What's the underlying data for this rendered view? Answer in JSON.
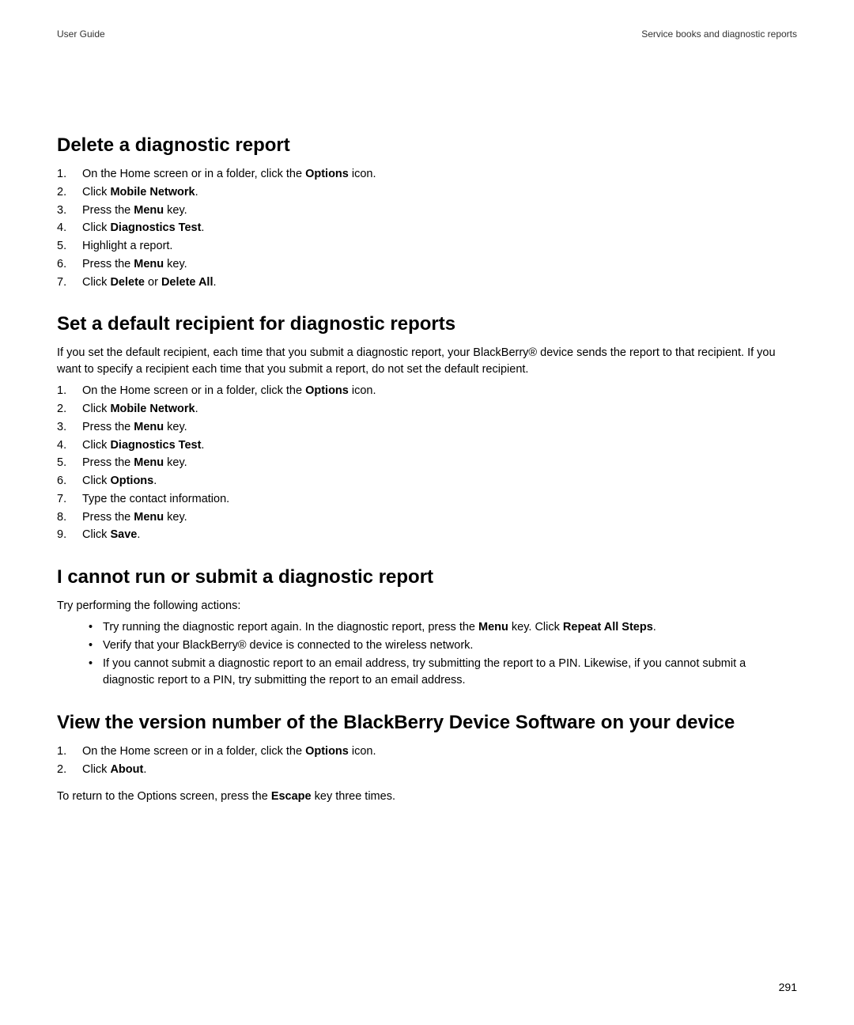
{
  "header": {
    "left": "User Guide",
    "right": "Service books and diagnostic reports"
  },
  "sections": {
    "s1": {
      "title": "Delete a diagnostic report",
      "steps": [
        {
          "pre": "On the Home screen or in a folder, click the ",
          "bold": "Options",
          "post": " icon."
        },
        {
          "pre": "Click ",
          "bold": "Mobile Network",
          "post": "."
        },
        {
          "pre": "Press the ",
          "bold": "Menu",
          "post": " key."
        },
        {
          "pre": "Click ",
          "bold": "Diagnostics Test",
          "post": "."
        },
        {
          "pre": "Highlight a report.",
          "bold": "",
          "post": ""
        },
        {
          "pre": "Press the ",
          "bold": "Menu",
          "post": " key."
        },
        {
          "pre": "Click ",
          "bold": "Delete",
          "mid": " or ",
          "bold2": "Delete All",
          "post": "."
        }
      ]
    },
    "s2": {
      "title": "Set a default recipient for diagnostic reports",
      "intro": "If you set the default recipient, each time that you submit a diagnostic report, your BlackBerry® device sends the report to that recipient. If you want to specify a recipient each time that you submit a report, do not set the default recipient.",
      "steps": [
        {
          "pre": "On the Home screen or in a folder, click the ",
          "bold": "Options",
          "post": " icon."
        },
        {
          "pre": "Click ",
          "bold": "Mobile Network",
          "post": "."
        },
        {
          "pre": "Press the ",
          "bold": "Menu",
          "post": " key."
        },
        {
          "pre": "Click ",
          "bold": "Diagnostics Test",
          "post": "."
        },
        {
          "pre": "Press the ",
          "bold": "Menu",
          "post": " key."
        },
        {
          "pre": "Click ",
          "bold": "Options",
          "post": "."
        },
        {
          "pre": "Type the contact information.",
          "bold": "",
          "post": ""
        },
        {
          "pre": "Press the ",
          "bold": "Menu",
          "post": " key."
        },
        {
          "pre": "Click ",
          "bold": "Save",
          "post": "."
        }
      ]
    },
    "s3": {
      "title": "I cannot run or submit a diagnostic report",
      "intro": "Try performing the following actions:",
      "bullets": [
        {
          "pre": "Try running the diagnostic report again. In the diagnostic report, press the ",
          "bold": "Menu",
          "mid": " key. Click ",
          "bold2": "Repeat All Steps",
          "post": "."
        },
        {
          "pre": "Verify that your BlackBerry® device is connected to the wireless network.",
          "bold": "",
          "post": ""
        },
        {
          "pre": "If you cannot submit a diagnostic report to an email address, try submitting the report to a PIN. Likewise, if you cannot submit a diagnostic report to a PIN, try submitting the report to an email address.",
          "bold": "",
          "post": ""
        }
      ]
    },
    "s4": {
      "title": "View the version number of the BlackBerry Device Software on your device",
      "steps": [
        {
          "pre": "On the Home screen or in a folder, click the ",
          "bold": "Options",
          "post": " icon."
        },
        {
          "pre": "Click ",
          "bold": "About",
          "post": "."
        }
      ],
      "footer": {
        "pre": "To return to the Options screen, press the ",
        "bold": "Escape",
        "post": " key three times."
      }
    }
  },
  "page_number": "291"
}
